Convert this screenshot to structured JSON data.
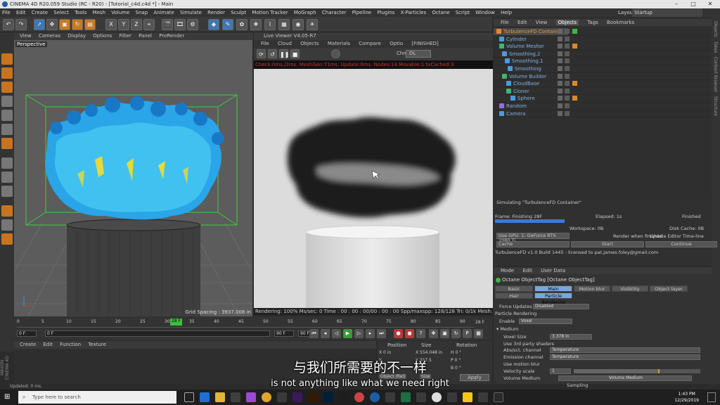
{
  "window": {
    "title": "CINEMA 4D R20.059 Studio (RC - R20) - [Tutorial_c4d.c4d *] - Main",
    "layout_label": "Layout:",
    "layout_value": "Startup"
  },
  "menu": [
    "File",
    "Edit",
    "Create",
    "Select",
    "Tools",
    "Mesh",
    "Volume",
    "Snap",
    "Animate",
    "Simulate",
    "Render",
    "Sculpt",
    "Motion Tracker",
    "MoGraph",
    "Character",
    "Pipeline",
    "Plugins",
    "X-Particles",
    "Octane",
    "Script",
    "Window",
    "Help"
  ],
  "viewport": {
    "menu": [
      "View",
      "Cameras",
      "Display",
      "Options",
      "Filter",
      "Panel",
      "ProRender"
    ],
    "label": "Perspective",
    "grid_spacing": "Grid Spacing : 3937.008 in"
  },
  "live_viewer": {
    "title": "Live Viewer V4.05-R7",
    "menu": [
      "File",
      "Cloud",
      "Objects",
      "Materials",
      "Compare",
      "Optio"
    ],
    "finished": "[FINISHED]",
    "channel_label": "Chn:",
    "channel_value": "DL",
    "status": "Check:0ms./2ms. MeshGen:71ms. Update:0ms. Nodes:14 Movable:1 txCached:3",
    "info": "Rendering: 100% Ms/sec: 0   Time : 00 : 00 : 00/00 : 00 : 00  Spp/maxspp: 128/128  Tri: 0/1k  Mesh: 1  Hair: 0    GPU:    10"
  },
  "timeline": {
    "ticks": [
      "0",
      "5",
      "10",
      "15",
      "20",
      "25",
      "30",
      "35",
      "40",
      "45",
      "50",
      "55",
      "60",
      "65",
      "70",
      "75",
      "80",
      "85",
      "90"
    ],
    "current_frame": "28 F",
    "start": "0 F",
    "min": "0 F",
    "max": "90 F",
    "end": "90 F",
    "frame_display": "28 F"
  },
  "material": {
    "menu": [
      "Create",
      "Edit",
      "Function",
      "Texture"
    ]
  },
  "maxon_logo": "MAXON CINEMA 4D",
  "coordinates": {
    "headers": [
      "Position",
      "Size",
      "Rotation"
    ],
    "rows": [
      {
        "axis": "X",
        "pos": "0 in",
        "size_axis": "X",
        "size": "554.048 in",
        "rot_axis": "H",
        "rot": "0 °"
      },
      {
        "axis": "Y",
        "pos": "",
        "size_axis": "Y",
        "size": "337.5",
        "rot_axis": "P",
        "rot": "0 °"
      },
      {
        "axis": "Z",
        "pos": "",
        "size_axis": "Z",
        "size": "",
        "rot_axis": "B",
        "rot": "0 °"
      }
    ],
    "mode_1": "Object (Rel)",
    "mode_2": "Size",
    "apply": "Apply"
  },
  "status_bar": "Updated: 0 ms.",
  "object_manager": {
    "tabs": [
      "File",
      "Edit",
      "View",
      "Objects",
      "Tags",
      "Bookmarks"
    ],
    "active_tab": "Objects",
    "objects": [
      {
        "name": "TurbulenceFD Container",
        "highlight": true,
        "color": "#e08a2a"
      },
      {
        "name": "Cylinder",
        "color": "#4a9ae0"
      },
      {
        "name": "Volume Mesher",
        "color": "#3cb870"
      },
      {
        "name": "Smoothing.2",
        "color": "#4a9ae0"
      },
      {
        "name": "Smoothing.1",
        "color": "#4a9ae0"
      },
      {
        "name": "Smoothing",
        "color": "#4a9ae0"
      },
      {
        "name": "Volume Builder",
        "color": "#3cb870"
      },
      {
        "name": "CloudBase",
        "color": "#4a9ae0"
      },
      {
        "name": "Cloner",
        "color": "#3cb870"
      },
      {
        "name": "Sphere",
        "color": "#4a9ae0"
      },
      {
        "name": "Random",
        "color": "#9a6ae0"
      },
      {
        "name": "Camera",
        "color": "#4a9ae0"
      }
    ]
  },
  "right_strip": [
    "Objects",
    "Takes",
    "Content Browser",
    "Structure"
  ],
  "turbulence": {
    "simulating": "Simulating \"TurbulenceFD Container\"",
    "frame": "Frame: Finishing 28F",
    "elapsed": "Elapsed: 1s",
    "finished": "Finished",
    "progress": 0.33,
    "workspace": "Workspace: 0B",
    "disk_cache": "Disk Cache: 0B",
    "gpu": "Use GPU: 1: GeForce RTX 2080 Ti",
    "render_when_finished": "Render when finished",
    "update_editor": "Update Editor Time-line",
    "cache": "Cache",
    "start": "Start",
    "continue": "Continue",
    "build": "TurbulenceFD v1.0 Build 1445 - licensed to pat.james.foley@gmail.com"
  },
  "attributes": {
    "menu": [
      "Mode",
      "Edit",
      "User Data"
    ],
    "title": "Octane ObjectTag [Octane ObjectTag]",
    "tabs_row1": [
      "Basic",
      "Main",
      "Motion blur",
      "Visibility",
      "Object layer"
    ],
    "tabs_row2": [
      "Hair",
      "Particle Rendering"
    ],
    "active_tab": "Main",
    "rows": [
      {
        "label": "Force Updates",
        "value": "Disabled"
      },
      {
        "label": "Particle Rendering",
        "value": ""
      },
      {
        "label": "Enable",
        "value": "Voxel"
      },
      {
        "label": "▾ Medium",
        "value": ""
      },
      {
        "label": "Voxel Size",
        "value": "3.378 in"
      },
      {
        "label": "Use 3rd party shaders",
        "value": ""
      },
      {
        "label": "Abs/sct. channel",
        "value": "Temperature"
      },
      {
        "label": "Emission channel",
        "value": "Temperature"
      },
      {
        "label": "Use motion blur",
        "value": ""
      },
      {
        "label": "Velocity scale",
        "value": "1"
      },
      {
        "label": "Volume Medium",
        "value": "Volume Medium"
      }
    ],
    "sampling": "Sampling"
  },
  "subtitles": {
    "zh": "与我们所需要的不一样",
    "en": "is not anything like what we need right"
  },
  "taskbar": {
    "search_placeholder": "Type here to search",
    "time": "1:43 PM",
    "date": "12/29/2019"
  }
}
